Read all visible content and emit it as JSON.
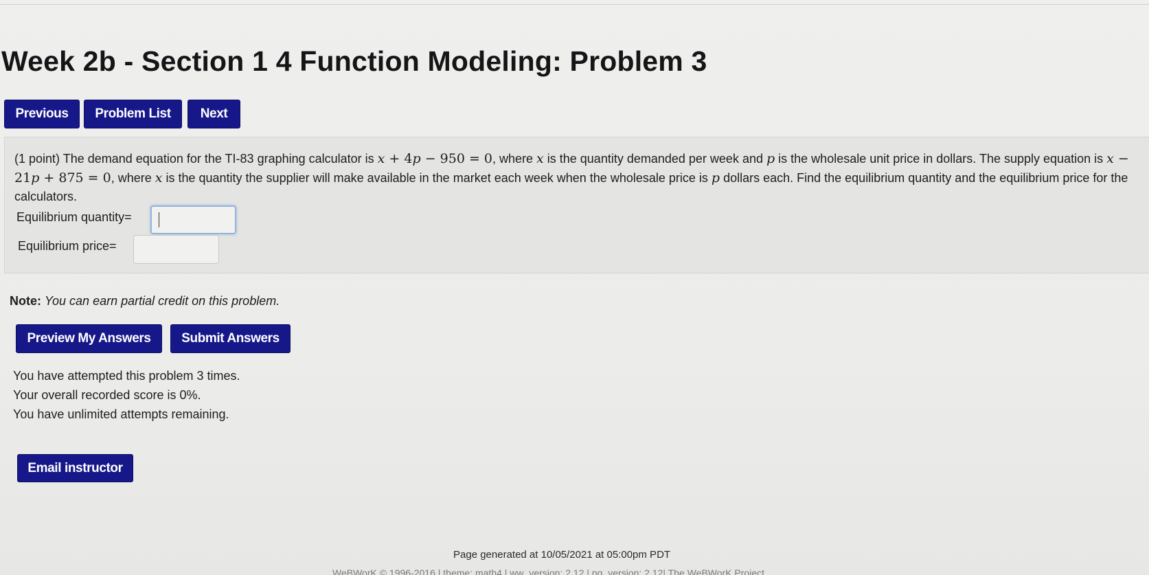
{
  "page": {
    "title": "Week 2b - Section 1 4 Function Modeling: Problem 3"
  },
  "nav": {
    "previous_label": "Previous",
    "problem_list_label": "Problem List",
    "next_label": "Next"
  },
  "problem": {
    "points": "(1 point)",
    "text_1": " The demand equation for the TI-83 graphing calculator is ",
    "text_2": ", where ",
    "text_3": " is the quantity demanded per week and ",
    "text_4": " is the wholesale unit price in dollars. The supply equation is ",
    "text_5": ", where ",
    "text_6": " is the quantity the supplier will make available in the market each week when the wholesale price is ",
    "text_7": " dollars each. Find the equilibrium quantity and the equilibrium price for the calculators.",
    "var_x": "x",
    "var_p": "p",
    "demand_eq": {
      "a": "x",
      "b": " + 4",
      "c": "p",
      "d": " − 950 = 0"
    },
    "supply_eq": {
      "a": "x",
      "b": " − 21",
      "c": "p",
      "d": " + 875 = 0"
    },
    "quantity_label": "Equilibrium quantity=",
    "price_label": "Equilibrium price=",
    "quantity_value": "",
    "price_value": ""
  },
  "note": {
    "label": "Note:",
    "text": "You can earn partial credit on this problem."
  },
  "actions": {
    "preview_label": "Preview My Answers",
    "submit_label": "Submit Answers"
  },
  "status": {
    "attempts": "You have attempted this problem 3 times.",
    "score": "Your overall recorded score is 0%.",
    "remaining": "You have unlimited attempts remaining."
  },
  "email": {
    "label": "Email instructor"
  },
  "footer": {
    "generated": "Page generated at 10/05/2021 at 05:00pm PDT",
    "credits": "WeBWorK © 1996-2016 | theme: math4 | ww_version: 2.12 | pg_version: 2.12| The WeBWorK Project"
  }
}
